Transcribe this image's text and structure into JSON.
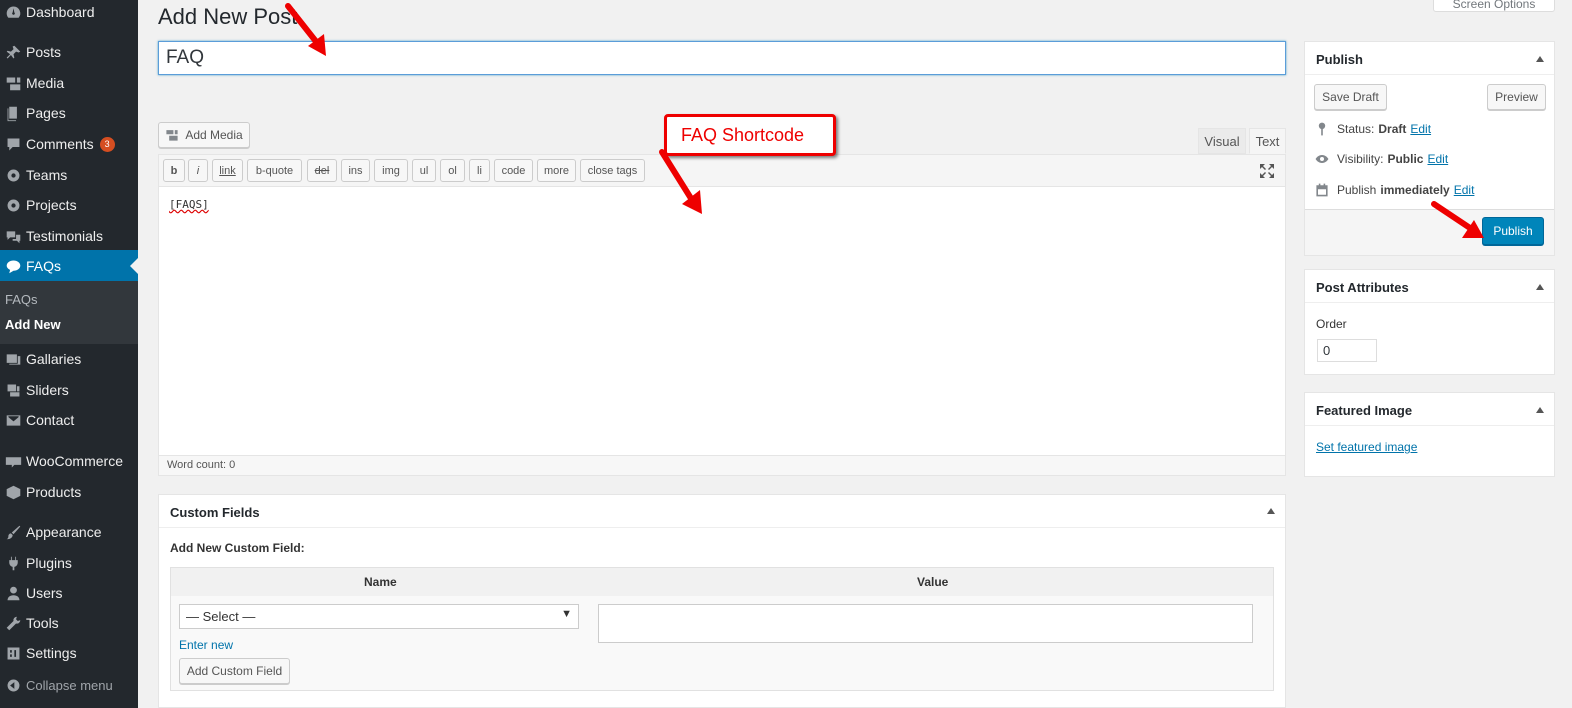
{
  "sidebar": {
    "items": [
      {
        "label": "Dashboard",
        "icon": "dashboard-icon"
      },
      {
        "label": "Posts",
        "icon": "pin-icon"
      },
      {
        "label": "Media",
        "icon": "media-icon"
      },
      {
        "label": "Pages",
        "icon": "pages-icon"
      },
      {
        "label": "Comments",
        "icon": "comment-icon",
        "badge": "3"
      },
      {
        "label": "Teams",
        "icon": "gear-icon"
      },
      {
        "label": "Projects",
        "icon": "gear-icon"
      },
      {
        "label": "Testimonials",
        "icon": "testimonial-icon"
      },
      {
        "label": "FAQs",
        "icon": "chat-bubble-icon"
      },
      {
        "label": "Gallaries",
        "icon": "gallery-icon"
      },
      {
        "label": "Sliders",
        "icon": "slides-icon"
      },
      {
        "label": "Contact",
        "icon": "mail-icon"
      },
      {
        "label": "WooCommerce",
        "icon": "woo-icon"
      },
      {
        "label": "Products",
        "icon": "box-icon"
      },
      {
        "label": "Appearance",
        "icon": "brush-icon"
      },
      {
        "label": "Plugins",
        "icon": "plug-icon"
      },
      {
        "label": "Users",
        "icon": "user-icon"
      },
      {
        "label": "Tools",
        "icon": "wrench-icon"
      },
      {
        "label": "Settings",
        "icon": "settings-icon"
      }
    ],
    "submenu": {
      "faqs": "FAQs",
      "add_new": "Add New"
    },
    "collapse": "Collapse menu"
  },
  "screen_options": "Screen Options",
  "page": {
    "title": "Add New Post",
    "post_title_value": "FAQ"
  },
  "editor": {
    "add_media": "Add Media",
    "tab_visual": "Visual",
    "tab_text": "Text",
    "quicktags": [
      "b",
      "i",
      "link",
      "b-quote",
      "del",
      "ins",
      "img",
      "ul",
      "ol",
      "li",
      "code",
      "more",
      "close tags"
    ],
    "content": "[FAQS]",
    "word_count": "Word count: 0"
  },
  "callout": "FAQ Shortcode",
  "custom_fields": {
    "title": "Custom Fields",
    "subtitle": "Add New Custom Field:",
    "col_name": "Name",
    "col_value": "Value",
    "select_value": "— Select —",
    "enter_new": "Enter new",
    "add_button": "Add Custom Field"
  },
  "publish": {
    "title": "Publish",
    "save_draft": "Save Draft",
    "preview": "Preview",
    "status_label": "Status:",
    "status_value": "Draft",
    "visibility_label": "Visibility:",
    "visibility_value": "Public",
    "publish_label": "Publish",
    "publish_value": "immediately",
    "edit": "Edit",
    "publish_button": "Publish"
  },
  "attributes": {
    "title": "Post Attributes",
    "order_label": "Order",
    "order_value": "0"
  },
  "featured": {
    "title": "Featured Image",
    "link": "Set featured image"
  },
  "colors": {
    "sidebar_bg": "#23282d",
    "active_menu": "#0073aa",
    "publish_button": "#0085ba",
    "annotation_red": "#e00000"
  }
}
